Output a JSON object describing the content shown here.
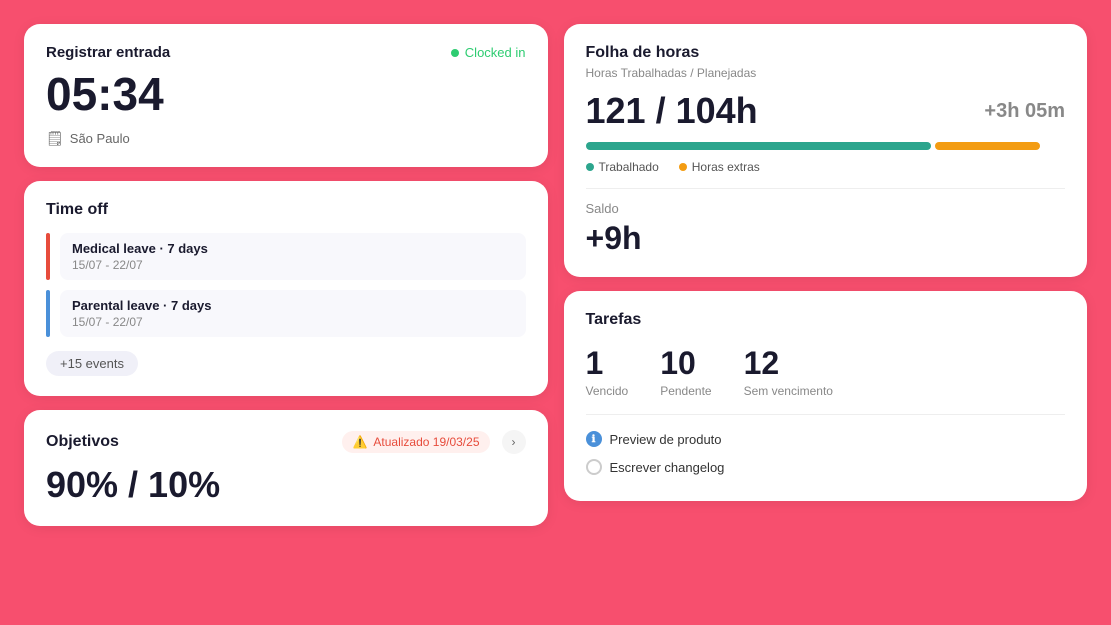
{
  "clockin": {
    "title": "Registrar entrada",
    "badge": "Clocked in",
    "time": "05:34",
    "location": "São Paulo"
  },
  "timeoff": {
    "title": "Time off",
    "leaves": [
      {
        "name": "Medical leave · 7 days",
        "dates": "15/07 - 22/07",
        "color": "red"
      },
      {
        "name": "Parental leave · 7 days",
        "dates": "15/07 - 22/07",
        "color": "blue"
      }
    ],
    "more": "+15 events"
  },
  "objetivos": {
    "title": "Objetivos",
    "badge": "Atualizado 19/03/25",
    "value": "90% / 10%"
  },
  "folha": {
    "title": "Folha de horas",
    "subtitle": "Horas Trabalhadas / Planejadas",
    "hours": "121 / 104h",
    "extra": "+3h 05m",
    "legend_worked": "Trabalhado",
    "legend_extra": "Horas extras",
    "saldo_label": "Saldo",
    "saldo_value": "+9h"
  },
  "tarefas": {
    "title": "Tarefas",
    "stats": [
      {
        "num": "1",
        "label": "Vencido"
      },
      {
        "num": "10",
        "label": "Pendente"
      },
      {
        "num": "12",
        "label": "Sem vencimento"
      }
    ],
    "tasks": [
      {
        "name": "Preview de produto",
        "icon": "blue-filled"
      },
      {
        "name": "Escrever changelog",
        "icon": "outline"
      }
    ]
  }
}
